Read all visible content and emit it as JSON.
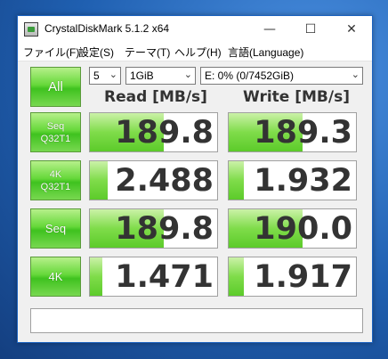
{
  "window": {
    "title": "CrystalDiskMark 5.1.2 x64",
    "controls": {
      "minimize": "—",
      "maximize": "☐",
      "close": "✕"
    }
  },
  "menu": [
    "ファイル(F)",
    "設定(S)",
    "テーマ(T)",
    "ヘルプ(H)",
    "言語(Language)"
  ],
  "toolbar": {
    "all_label": "All",
    "count": "5",
    "size": "1GiB",
    "drive": "E: 0% (0/7452GiB)"
  },
  "headers": {
    "read": "Read [MB/s]",
    "write": "Write [MB/s]"
  },
  "rows": [
    {
      "label_line1": "Seq",
      "label_line2": "Q32T1",
      "read": "189.8",
      "write": "189.3",
      "read_level": 0.58,
      "write_level": 0.58
    },
    {
      "label_line1": "4K",
      "label_line2": "Q32T1",
      "read": "2.488",
      "write": "1.932",
      "read_level": 0.14,
      "write_level": 0.12
    },
    {
      "label_line1": "Seq",
      "label_line2": "",
      "read": "189.8",
      "write": "190.0",
      "read_level": 0.58,
      "write_level": 0.58
    },
    {
      "label_line1": "4K",
      "label_line2": "",
      "read": "1.471",
      "write": "1.917",
      "read_level": 0.1,
      "write_level": 0.12
    }
  ],
  "comment": ""
}
